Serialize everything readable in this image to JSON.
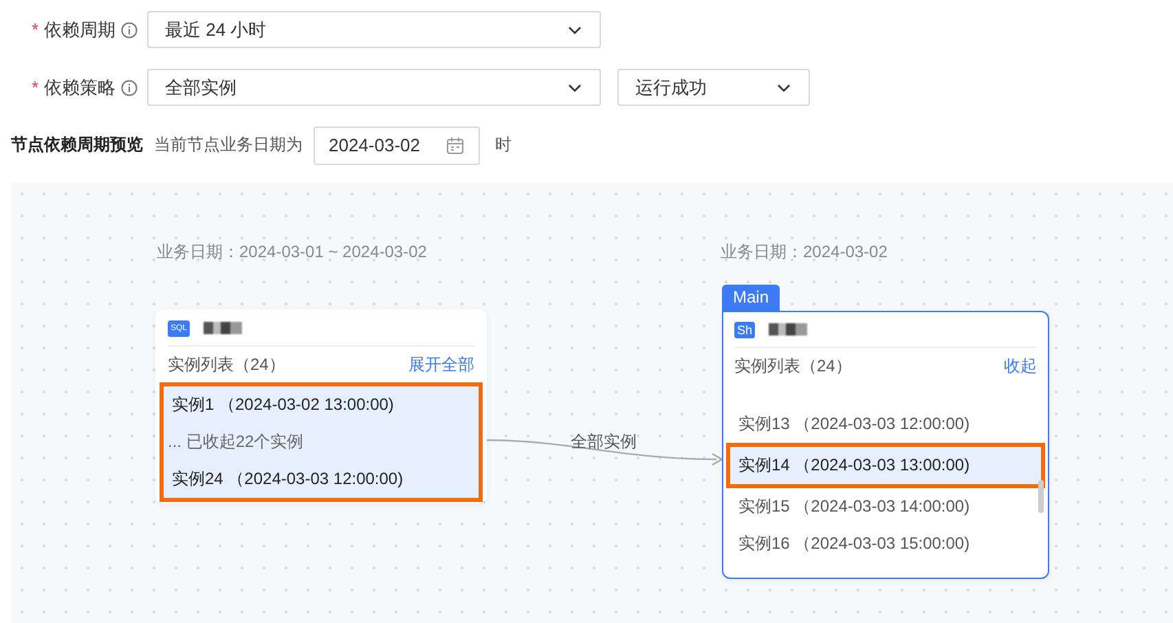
{
  "form": {
    "rows": [
      {
        "label": "依赖周期",
        "required_mark": "*",
        "selects": [
          {
            "value": "最近 24 小时"
          }
        ]
      },
      {
        "label": "依赖策略",
        "required_mark": "*",
        "selects": [
          {
            "value": "全部实例"
          },
          {
            "value": "运行成功"
          }
        ]
      }
    ]
  },
  "preview": {
    "title": "节点依赖周期预览",
    "prefix": "当前节点业务日期为",
    "date": "2024-03-02",
    "suffix": "时"
  },
  "graph": {
    "nodes": [
      {
        "date_label": "业务日期：2024-03-01 ~ 2024-03-02",
        "type_badge": "SQL",
        "list_title": "实例列表（24）",
        "toggle": "展开全部",
        "active": false,
        "scrollable": false,
        "items": [
          {
            "kind": "instance",
            "text": "实例1 （2024-03-02 13:00:00)",
            "selected": true,
            "annotated": true
          },
          {
            "kind": "collapsed",
            "text": "... 已收起22个实例",
            "selected": true,
            "annotated": true
          },
          {
            "kind": "instance",
            "text": "实例24 （2024-03-03 12:00:00)",
            "selected": true,
            "annotated": true
          }
        ]
      },
      {
        "date_label": "业务日期：2024-03-02",
        "tag": "Main",
        "type_badge": "Sh",
        "list_title": "实例列表（24）",
        "toggle": "收起",
        "active": true,
        "scrollable": true,
        "items": [
          {
            "kind": "instance",
            "text": "实例13 （2024-03-03 12:00:00)",
            "selected": false,
            "annotated": false
          },
          {
            "kind": "instance",
            "text": "实例14 （2024-03-03 13:00:00)",
            "selected": true,
            "annotated": true
          },
          {
            "kind": "instance",
            "text": "实例15 （2024-03-03 14:00:00)",
            "selected": false,
            "annotated": false
          },
          {
            "kind": "instance",
            "text": "实例16 （2024-03-03 15:00:00)",
            "selected": false,
            "annotated": false
          }
        ]
      }
    ],
    "edges": [
      {
        "label": "全部实例"
      }
    ]
  }
}
